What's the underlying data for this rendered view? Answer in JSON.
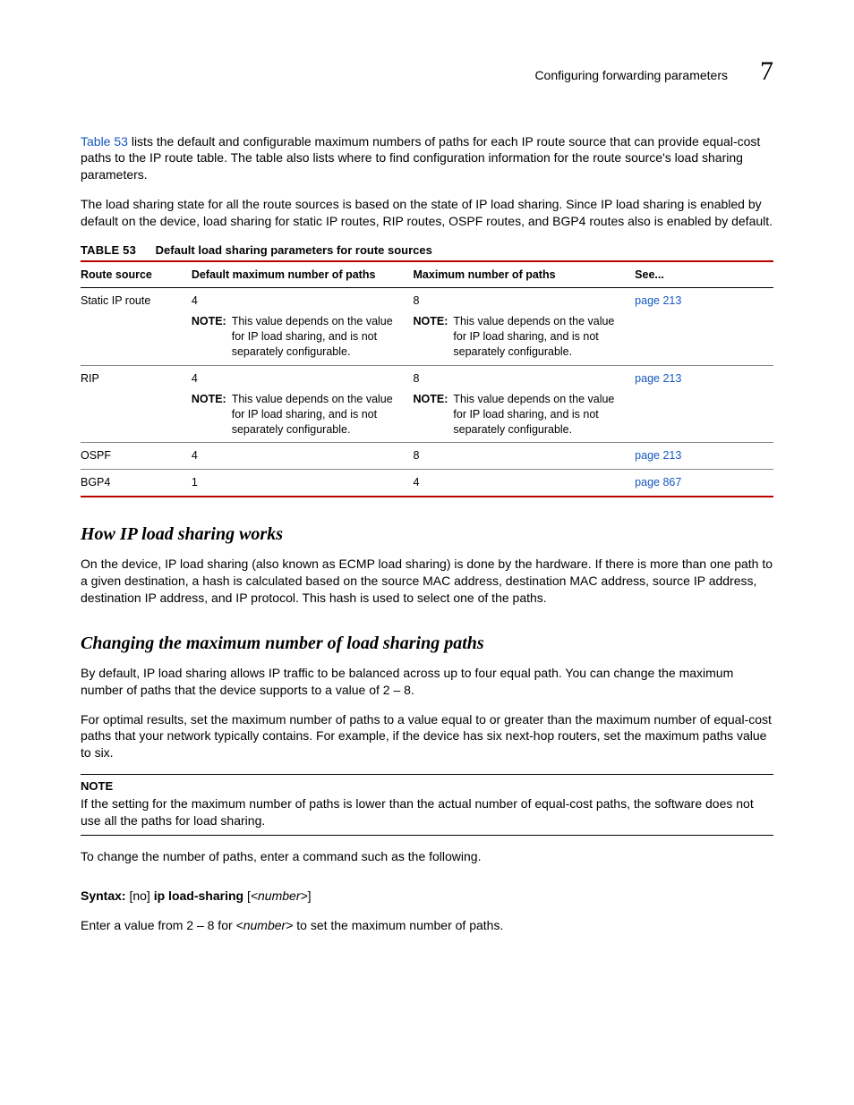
{
  "header": {
    "title": "Configuring forwarding parameters",
    "chapter": "7"
  },
  "intro": {
    "link": "Table 53",
    "text_after_link": " lists the default and configurable maximum numbers of paths for each IP route source that can provide equal-cost paths to the IP route table. The table also lists where to find configuration information for the route source's load sharing parameters.",
    "para2": "The load sharing state for all the route sources is based on the state of IP load sharing. Since IP load sharing is enabled by default on the device, load sharing for static IP routes, RIP routes, OSPF routes, and BGP4 routes also is enabled by default."
  },
  "table": {
    "label": "TABLE 53",
    "caption": "Default load sharing parameters for route sources",
    "headers": {
      "c1": "Route source",
      "c2": "Default maximum number of paths",
      "c3": "Maximum number of paths",
      "c4": "See..."
    },
    "note_label": "NOTE:",
    "rows": [
      {
        "src": "Static IP route",
        "def": "4",
        "def_note": "This value depends on the value for IP load sharing, and is not separately configurable.",
        "max": "8",
        "max_note": "This value depends on the value for IP load sharing, and is not separately configurable.",
        "see": "page 213"
      },
      {
        "src": "RIP",
        "def": "4",
        "def_note": "This value depends on the value for IP load sharing, and is not separately configurable.",
        "max": "8",
        "max_note": "This value depends on the value for IP load sharing, and is not separately configurable.",
        "see": "page 213"
      },
      {
        "src": "OSPF",
        "def": "4",
        "def_note": "",
        "max": "8",
        "max_note": "",
        "see": "page 213"
      },
      {
        "src": "BGP4",
        "def": "1",
        "def_note": "",
        "max": "4",
        "max_note": "",
        "see": "page 867"
      }
    ]
  },
  "section1": {
    "heading": "How IP load sharing works",
    "para": "On the device, IP load sharing (also known as ECMP load sharing) is done by the hardware. If there is more than one path to a given destination, a hash is calculated based on the source MAC address, destination MAC address, source IP address, destination IP address, and IP protocol. This hash is used to select one of the paths."
  },
  "section2": {
    "heading": "Changing the maximum number of load sharing paths",
    "para1": "By default, IP load sharing allows IP traffic to be balanced across up to four equal path. You can change the maximum number of paths that the device supports to a value of 2 – 8.",
    "para2": "For optimal results, set the maximum number of paths to a value equal to or greater than the maximum number of equal-cost paths that your network typically contains. For example, if the device has six next-hop routers, set the maximum paths value to six.",
    "note_head": "NOTE",
    "note_body": "If the setting for the maximum number of paths is lower than the actual number of equal-cost paths, the software does not use all the paths for load sharing.",
    "para3": "To change the number of paths, enter a command such as the following.",
    "syntax_label": "Syntax:",
    "syntax_cmd_pre": "  [no] ",
    "syntax_cmd_bold": "ip load-sharing",
    "syntax_cmd_post": " [",
    "syntax_cmd_var": "<number>",
    "syntax_cmd_end": "]",
    "para4_pre": "Enter a value from 2 – 8 for ",
    "para4_var": "<number>",
    "para4_post": " to set the maximum number of paths."
  }
}
